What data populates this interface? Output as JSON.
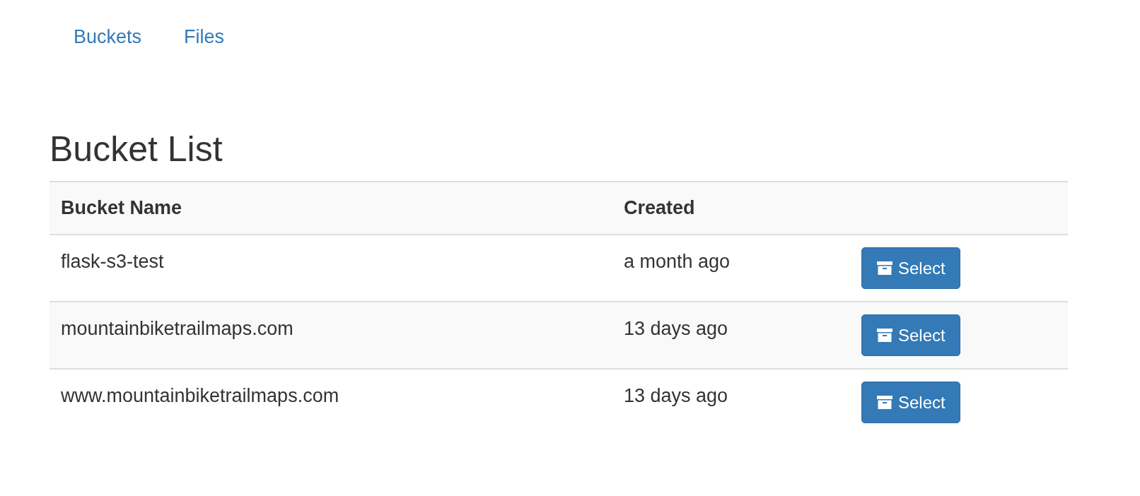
{
  "nav": {
    "links": [
      {
        "label": "Buckets"
      },
      {
        "label": "Files"
      }
    ]
  },
  "heading": "Bucket List",
  "table": {
    "columns": [
      "Bucket Name",
      "Created"
    ],
    "rows": [
      {
        "name": "flask-s3-test",
        "created": "a month ago",
        "action": "Select"
      },
      {
        "name": "mountainbiketrailmaps.com",
        "created": "13 days ago",
        "action": "Select"
      },
      {
        "name": "www.mountainbiketrailmaps.com",
        "created": "13 days ago",
        "action": "Select"
      }
    ]
  }
}
